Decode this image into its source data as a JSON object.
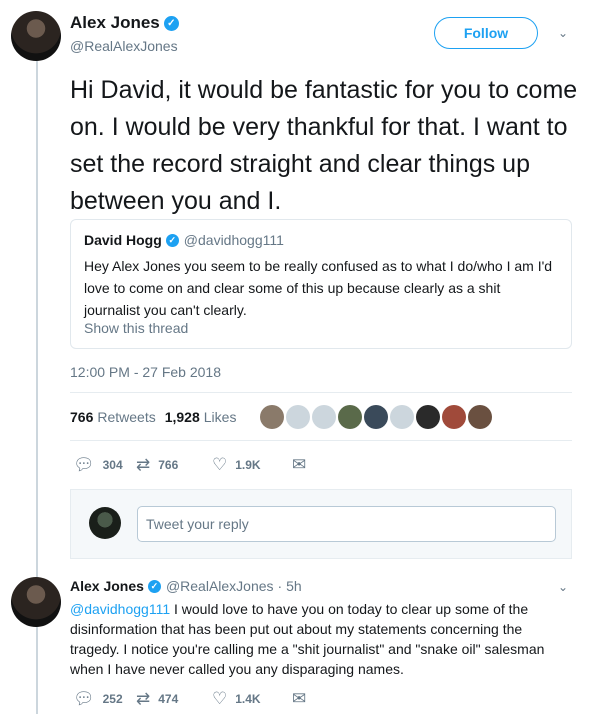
{
  "main_tweet": {
    "author_name": "Alex Jones",
    "author_handle": "@RealAlexJones",
    "follow_label": "Follow",
    "text": "Hi David, it would be fantastic for you to come on. I would be very thankful for that. I want to set the record straight and clear things up between you and I.",
    "quote": {
      "author_name": "David Hogg",
      "author_handle": "@davidhogg111",
      "text": "Hey Alex Jones you seem to be really confused as to what I do/who I am I'd love to come on and clear some of this up because clearly as a shit journalist you can't clearly.",
      "show_thread": "Show this thread"
    },
    "timestamp": "12:00 PM - 27 Feb 2018",
    "retweets_count": "766",
    "retweets_label": "Retweets",
    "likes_count": "1,928",
    "likes_label": "Likes",
    "actions": {
      "replies": "304",
      "retweets": "766",
      "likes": "1.9K"
    }
  },
  "reply_box": {
    "placeholder": "Tweet your reply"
  },
  "reply_tweet": {
    "author_name": "Alex Jones",
    "author_handle": "@RealAlexJones",
    "time": "· 5h",
    "mention": "@davidhogg111",
    "text": " I would love to have you on today to clear up some of the disinformation that has been put out about my statements concerning the tragedy. I notice you're calling me a \"shit journalist\" and \"snake oil\" salesman when I have never called you any disparaging names.",
    "actions": {
      "replies": "252",
      "retweets": "474",
      "likes": "1.4K"
    }
  },
  "icons": {
    "verified": "verified-badge-icon",
    "chevron": "chevron-down-icon",
    "reply": "reply-icon",
    "retweet": "retweet-icon",
    "like": "heart-icon",
    "dm": "envelope-icon"
  },
  "colors": {
    "accent": "#1da1f2",
    "muted": "#657786",
    "border": "#e1e8ed"
  }
}
